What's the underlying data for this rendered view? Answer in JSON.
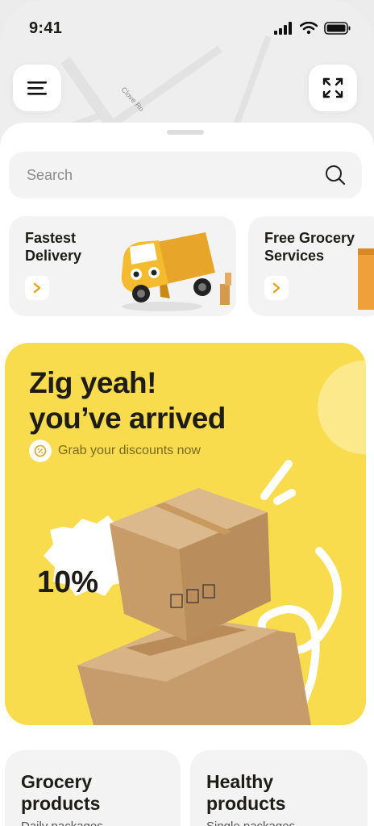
{
  "status_bar": {
    "time": "9:41"
  },
  "map": {
    "street_label": "Clove Ro"
  },
  "search": {
    "placeholder": "Search"
  },
  "services": [
    {
      "title_line1": "Fastest",
      "title_line2": "Delivery"
    },
    {
      "title_line1": "Free Grocery",
      "title_line2": "Services"
    }
  ],
  "promo": {
    "title_line1": "Zig yeah!",
    "title_line2": "you’ve arrived",
    "subtitle": "Grab your discounts now",
    "discount": "10%"
  },
  "categories": [
    {
      "title_line1": "Grocery",
      "title_line2": "products",
      "subtitle": "Daily packages"
    },
    {
      "title_line1": "Healthy",
      "title_line2": "products",
      "subtitle": "Single packages"
    }
  ],
  "colors": {
    "accent_yellow": "#f8dc4d",
    "arrow_orange": "#e5a21a",
    "card_bg": "#f3f3f3"
  },
  "icons": [
    "menu-icon",
    "expand-icon",
    "search-icon",
    "chevron-right-icon",
    "discount-icon"
  ]
}
